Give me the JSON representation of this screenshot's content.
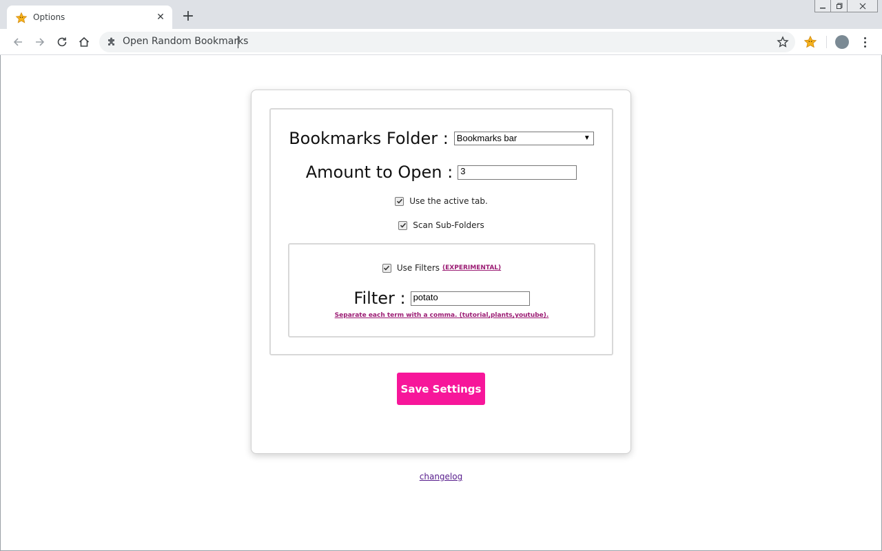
{
  "browser": {
    "tab_title": "Options",
    "tab_close": "✕",
    "new_tab": "+",
    "omnibox_text": "Open Random Bookmarks",
    "icons": [
      "star-favicon-icon",
      "back-icon",
      "forward-icon",
      "reload-icon",
      "home-icon",
      "puzzle-icon",
      "bookmark-star-icon",
      "extension-star-icon",
      "avatar",
      "menu-dots-icon"
    ]
  },
  "form": {
    "folder_label": "Bookmarks Folder :",
    "folder_selected": "Bookmarks bar",
    "amount_label": "Amount to Open :",
    "amount_value": "3",
    "use_active_tab_label": "Use the active tab.",
    "use_active_tab_checked": true,
    "scan_subfolders_label": "Scan Sub-Folders",
    "scan_subfolders_checked": true,
    "use_filters_label": "Use Filters",
    "use_filters_checked": true,
    "experimental_label": "(EXPERIMENTAL)",
    "filter_label": "Filter :",
    "filter_value": "potato",
    "filter_hint": "Separate each term with a comma. (tutorial,plants,youtube).",
    "save_label": "Save Settings"
  },
  "footer": {
    "changelog_label": "changelog"
  },
  "colors": {
    "accent": "#f7169a",
    "link_magenta": "#9b1b73",
    "visited_link": "#551a8b"
  }
}
